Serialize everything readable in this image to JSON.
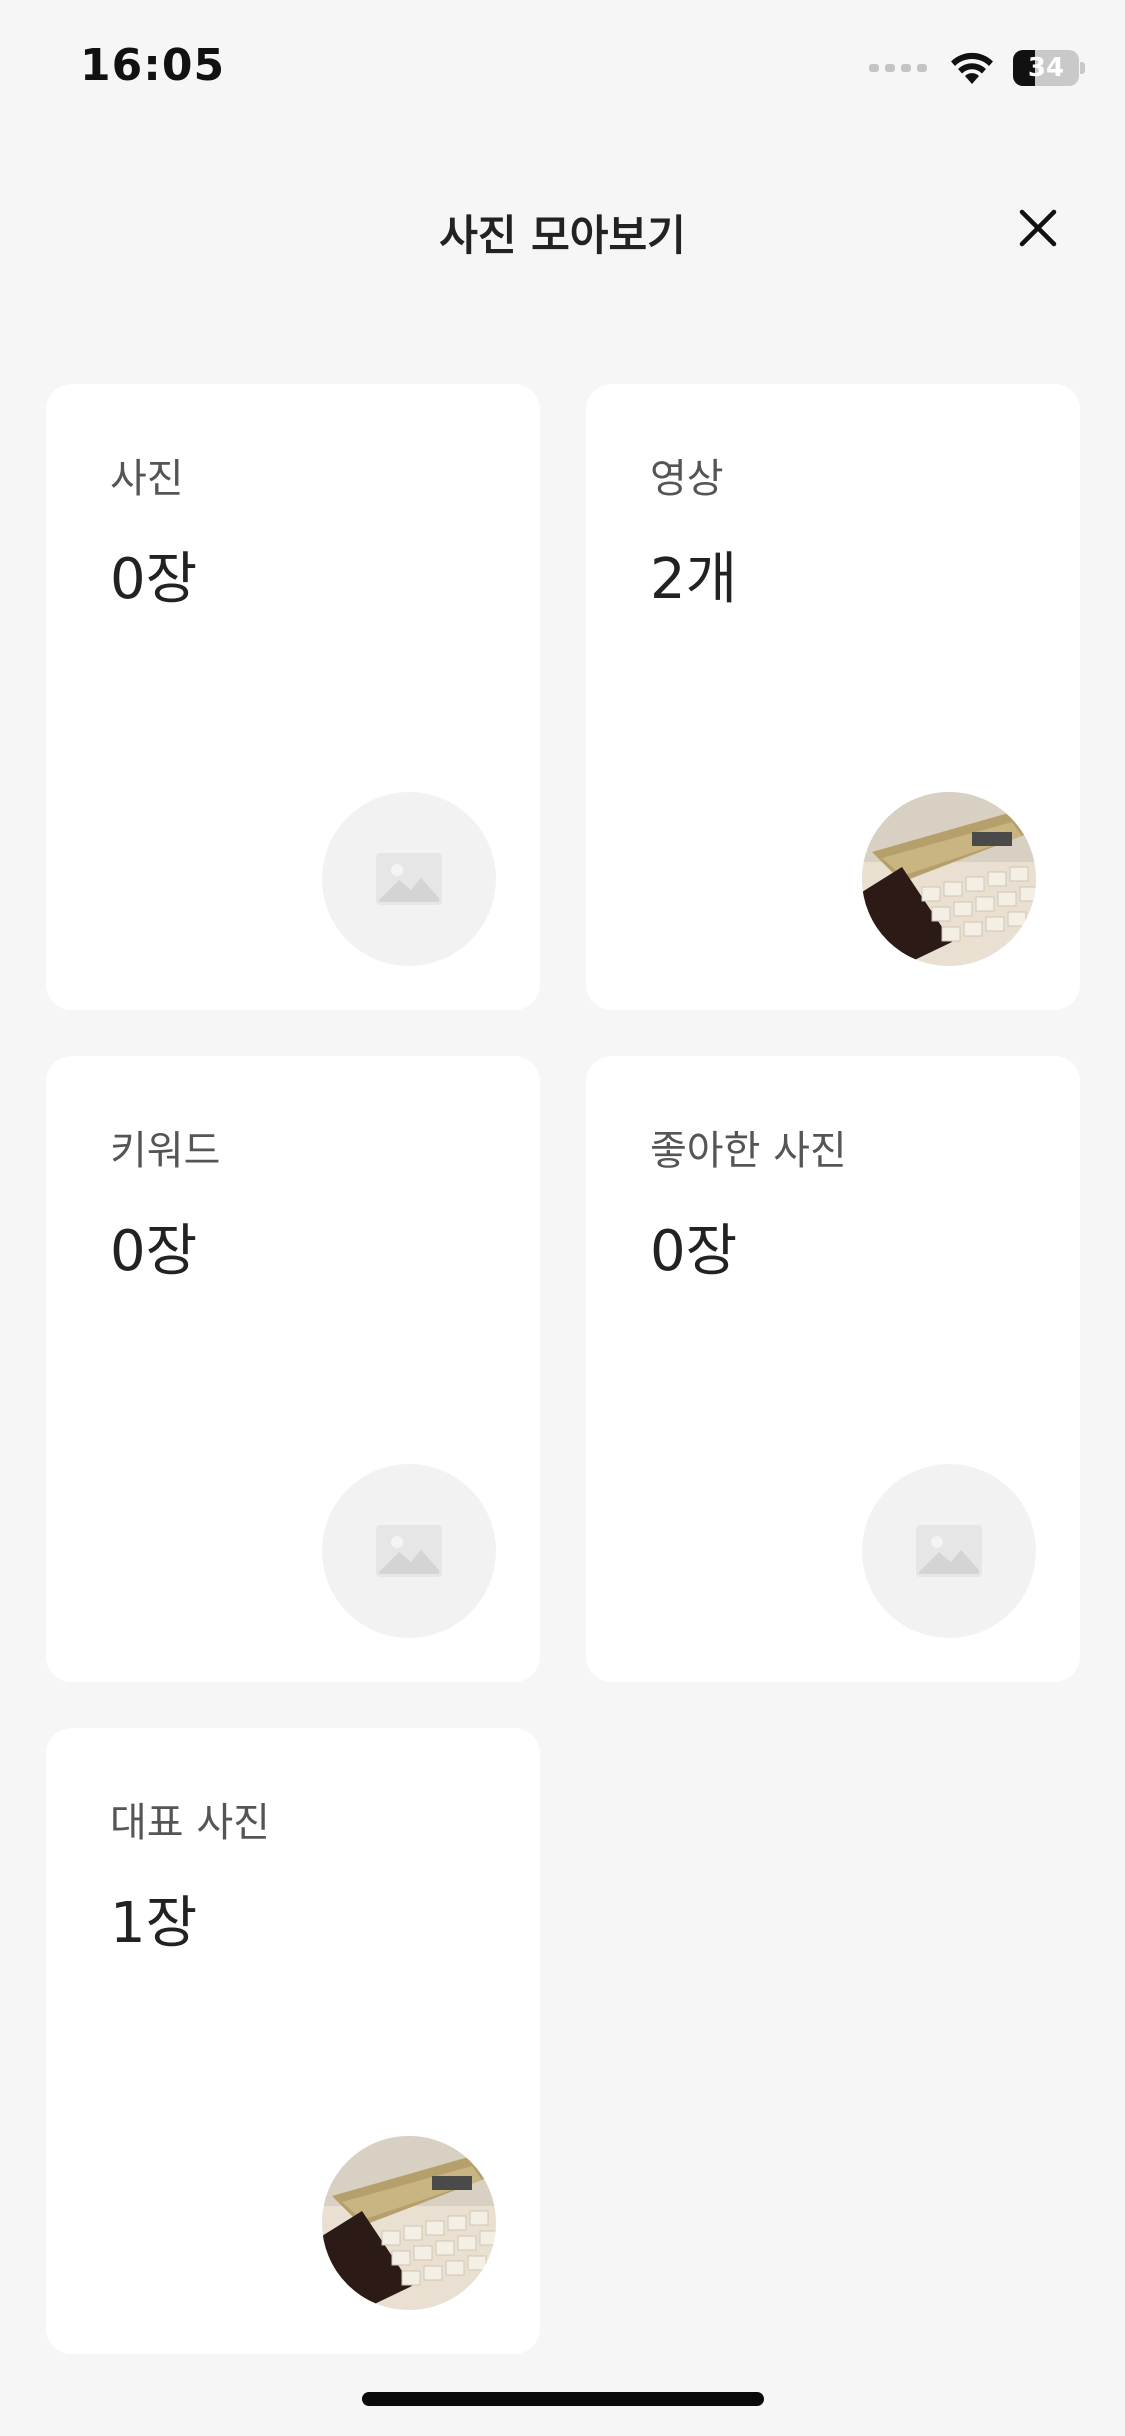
{
  "status_bar": {
    "time": "16:05",
    "battery": "34"
  },
  "header": {
    "title": "사진 모아보기"
  },
  "cards": [
    {
      "label": "사진",
      "count": "0장",
      "thumbnail": "image-placeholder-icon"
    },
    {
      "label": "영상",
      "count": "2개",
      "thumbnail": "photo-thumbnail"
    },
    {
      "label": "키워드",
      "count": "0장",
      "thumbnail": "image-placeholder-icon"
    },
    {
      "label": "좋아한 사진",
      "count": "0장",
      "thumbnail": "image-placeholder-icon"
    },
    {
      "label": "대표 사진",
      "count": "1장",
      "thumbnail": "photo-thumbnail"
    }
  ],
  "colors": {
    "background": "#f6f6f6",
    "card": "#ffffff",
    "text": "#222222",
    "label": "#555555"
  }
}
